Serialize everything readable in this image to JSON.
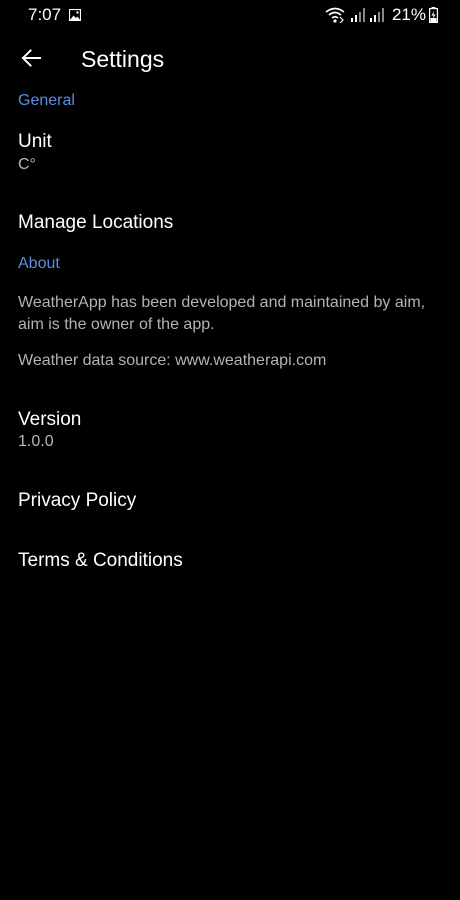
{
  "status_bar": {
    "time": "7:07",
    "battery": "21%",
    "icons": [
      "image-icon",
      "wifi-calling-icon",
      "signal-icon",
      "signal-icon",
      "battery-charging-icon"
    ]
  },
  "app_bar": {
    "title": "Settings",
    "back_icon": "arrow-back-icon"
  },
  "general": {
    "header": "General",
    "unit_title": "Unit",
    "unit_value": "C°",
    "manage_locations": "Manage Locations"
  },
  "about": {
    "header": "About",
    "description": "WeatherApp has been developed and maintained by aim, aim is the owner of the app.",
    "data_source": "Weather data source: www.weatherapi.com",
    "version_title": "Version",
    "version_value": "1.0.0",
    "privacy_policy": "Privacy Policy",
    "terms": "Terms & Conditions"
  },
  "colors": {
    "background": "#000000",
    "accent": "#5b8ee0",
    "text_primary": "#ffffff",
    "text_secondary": "#b3b3b3"
  }
}
